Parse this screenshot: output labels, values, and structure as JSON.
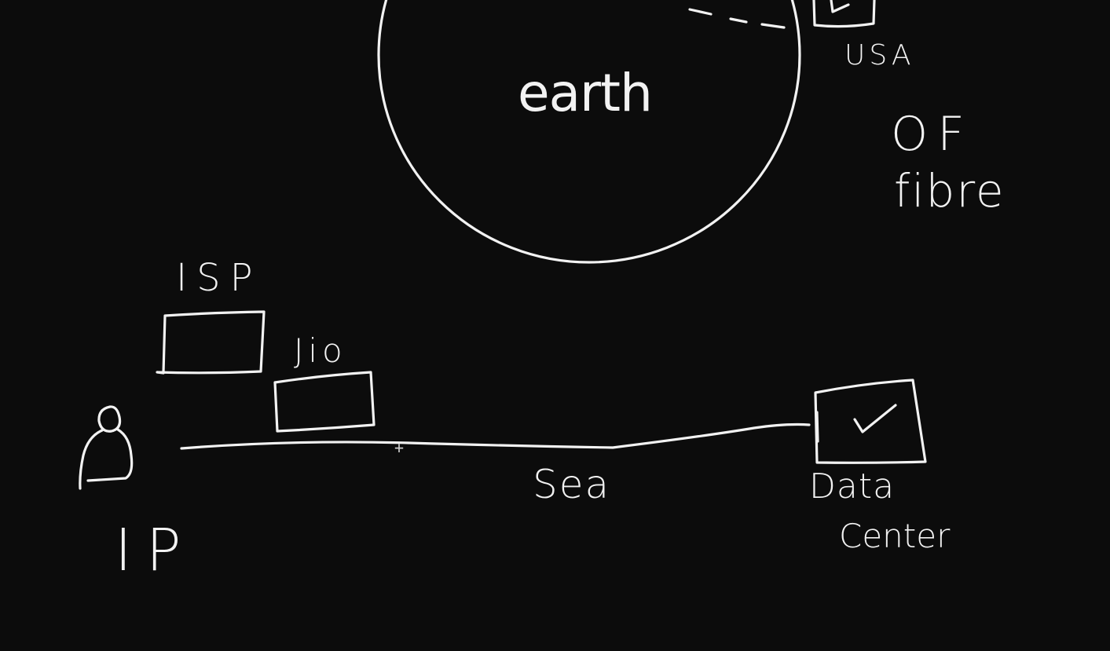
{
  "board": {
    "background": "#0c0c0c",
    "ink_color": "#f2f2f2"
  },
  "labels": {
    "earth": "earth",
    "usa": "USA",
    "of": "OF",
    "fibre": "fibre",
    "isp": "ISP",
    "jio": "Jio",
    "ip": "IP",
    "sea": "Sea",
    "data": "Data",
    "center": "Center"
  },
  "icons": {
    "play": "play-icon",
    "check": "check-icon",
    "user": "user-icon"
  }
}
